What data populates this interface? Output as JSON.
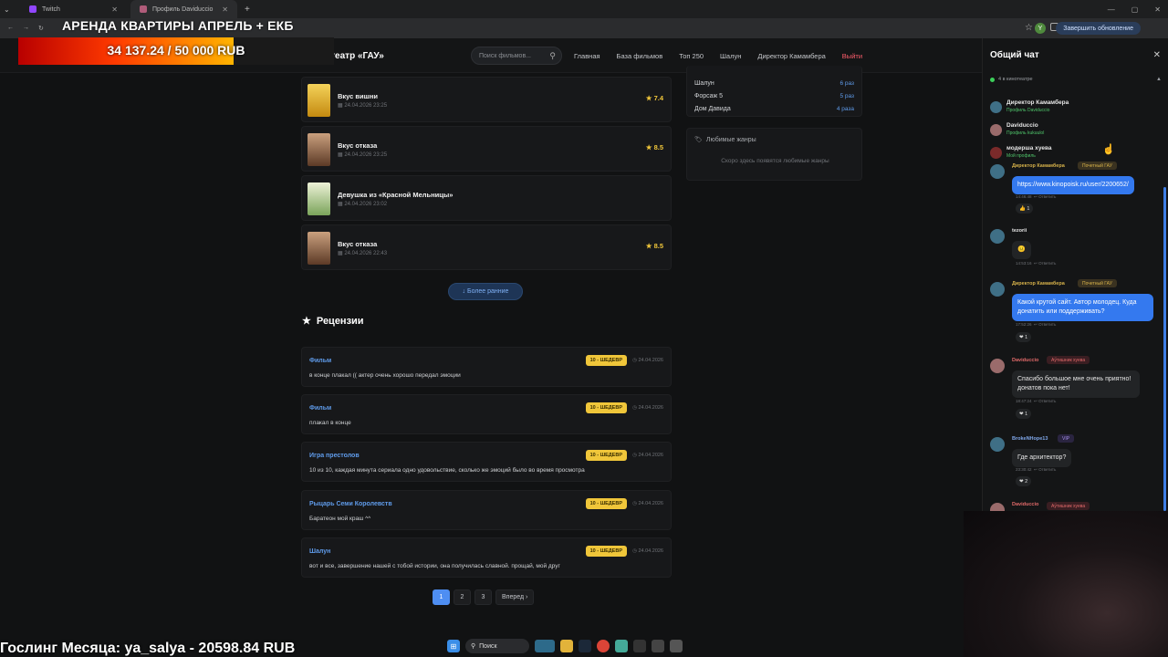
{
  "browser": {
    "tabs": [
      {
        "label": "Twitch",
        "active": false
      },
      {
        "label": "Профиль Daviduccio",
        "active": true
      }
    ],
    "update_button": "Завершить обновление",
    "profile_initial": "Y"
  },
  "overlay": {
    "title": "АРЕНДА КВАРТИРЫ АПРЕЛЬ + ЕКБ",
    "donation_text": "34 137.24 / 50 000 RUB",
    "donation_progress": 0.6827,
    "bottom_text": "Гослинг Месяца: ya_salya - 20598.84 RUB"
  },
  "site": {
    "logo": "Кинотеатр «ГАУ»",
    "search_placeholder": "Поиск фильмов...",
    "nav": [
      "Главная",
      "База фильмов",
      "Топ 250",
      "Шалун",
      "Директор Камамбера",
      "Выйти"
    ]
  },
  "watched": [
    {
      "title": "Вкус вишни",
      "date": "24.04.2026 23:25",
      "rating": "7.4",
      "poster": "#e0b020"
    },
    {
      "title": "Вкус отказа",
      "date": "24.04.2026 23:25",
      "rating": "8.5",
      "poster": "#8a5a3c"
    },
    {
      "title": "Девушка из «Красной Мельницы»",
      "date": "24.04.2026 23:02",
      "rating": "",
      "poster": "#c9d9a8"
    },
    {
      "title": "Вкус отказа",
      "date": "24.04.2026 22:43",
      "rating": "8.5",
      "poster": "#8a5a3c"
    }
  ],
  "more_button": "Более ранние",
  "reviews": {
    "heading": "Рецензии",
    "items": [
      {
        "title": "Фильм",
        "text": "в конце плакал (( актер очень хорошо передал эмоции",
        "badge": "10 - ШЕДЕВР",
        "date": "24.04.2026"
      },
      {
        "title": "Фильм",
        "text": "плакал в конце",
        "badge": "10 - ШЕДЕВР",
        "date": "24.04.2026"
      },
      {
        "title": "Игра престолов",
        "text": "10 из 10, каждая минута сериала одно удовольствие, сколько же эмоций было во время просмотра",
        "badge": "10 - ШЕДЕВР",
        "date": "24.04.2026"
      },
      {
        "title": "Рыцарь Семи Королевств",
        "text": "Баратеон мой краш ^^",
        "badge": "10 - ШЕДЕВР",
        "date": "24.04.2026"
      },
      {
        "title": "Шалун",
        "text": "вот и все, завершение нашей с тобой истории, она получилась славной. прощай, мой друг",
        "badge": "10 - ШЕДЕВР",
        "date": "24.04.2026"
      }
    ]
  },
  "pager": {
    "pages": [
      "1",
      "2",
      "3"
    ],
    "next": "Вперед"
  },
  "stats": [
    {
      "name": "Шалун",
      "count": "6 раз"
    },
    {
      "name": "Форсаж 5",
      "count": "5 раз"
    },
    {
      "name": "Дом Давида",
      "count": "4 раза"
    }
  ],
  "genres": {
    "heading": "Любимые жанры",
    "empty": "Скоро здесь появятся любимые жанры"
  },
  "chat": {
    "title": "Общий чат",
    "online": "4 в кинотеатре",
    "users": [
      {
        "name": "Директор Камамбера",
        "sub": "Профиль Daviduccio",
        "color": "#3f6f86"
      },
      {
        "name": "Daviduccio",
        "sub": "Профиль kukuulol",
        "color": "#9a6b6b"
      },
      {
        "name": "модерша хуева",
        "sub": "Мой профиль",
        "color": "#7a2a2a"
      }
    ],
    "messages": [
      {
        "author": "Директор Камамбера",
        "tag": "Почетный ГАУ",
        "text": "https://www.kinopoisk.ru/user/2200652/",
        "time": "14:46:48",
        "reply": "Ответить",
        "reaction": "👍 1",
        "style": "blue",
        "color": "#d7b24a"
      },
      {
        "author": "tezorii",
        "tag": "",
        "text": "😐",
        "time": "14:53:16",
        "reply": "Ответить",
        "reaction": "",
        "style": "dark",
        "color": "#e6e6e6"
      },
      {
        "author": "Директор Камамбера",
        "tag": "Почетный ГАУ",
        "text": "Какой крутой сайт. Автор молодец. Куда донатить или поддерживать?",
        "time": "17:52:26",
        "reply": "Ответить",
        "reaction": "❤ 1",
        "style": "blue",
        "color": "#d7b24a"
      },
      {
        "author": "Daviduccio",
        "tag": "Аўтишник хуева",
        "text": "Спасибо большое мне очень приятно! донатов пока нет!",
        "time": "18:47:24",
        "reply": "Ответить",
        "reaction": "❤ 1",
        "style": "dark",
        "color": "#e26a6a"
      },
      {
        "author": "BrokeNHope13",
        "tag": "VIP",
        "text": "Где архитектор?",
        "time": "23:30:42",
        "reply": "Ответить",
        "reaction": "❤ 2",
        "style": "dark",
        "color": "#7fa6e8"
      },
      {
        "author": "Daviduccio",
        "tag": "Аўтишник хуева",
        "text": "",
        "time": "",
        "reply": "",
        "reaction": "",
        "style": "dark",
        "color": "#e26a6a"
      }
    ]
  },
  "taskbar": {
    "search": "Поиск"
  }
}
